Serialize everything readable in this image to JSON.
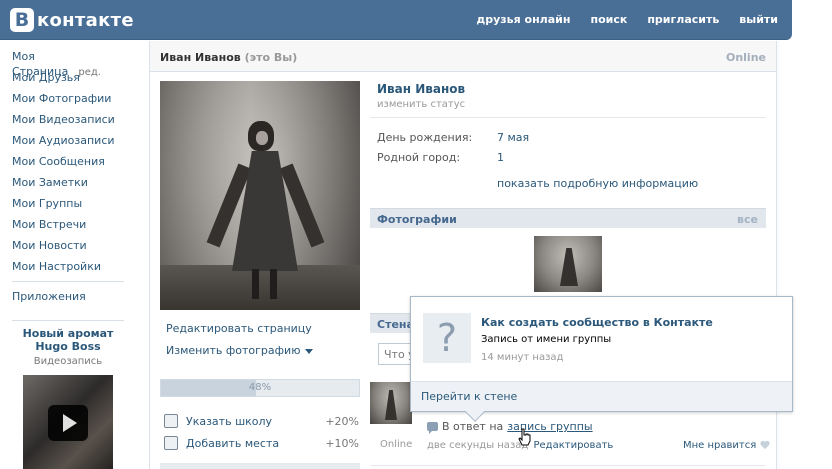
{
  "header": {
    "logo_letter": "B",
    "logo_text": "контакте",
    "nav": [
      "друзья онлайн",
      "поиск",
      "пригласить",
      "выйти"
    ]
  },
  "leftnav": {
    "items": [
      {
        "label": "Моя Страница",
        "extra": "ред."
      },
      {
        "label": "Мои Друзья"
      },
      {
        "label": "Мои Фотографии"
      },
      {
        "label": "Мои Видеозаписи"
      },
      {
        "label": "Мои Аудиозаписи"
      },
      {
        "label": "Мои Сообщения"
      },
      {
        "label": "Мои Заметки"
      },
      {
        "label": "Мои Группы"
      },
      {
        "label": "Мои Встречи"
      },
      {
        "label": "Мои Новости"
      },
      {
        "label": "Мои Настройки"
      }
    ],
    "apps": "Приложения"
  },
  "ad": {
    "title": "Новый аромат Hugo Boss",
    "subtitle": "Видеозапись"
  },
  "profile": {
    "title": "Иван Иванов",
    "title_note": "(это Вы)",
    "online": "Online",
    "name": "Иван Иванов",
    "change_status": "изменить статус",
    "birthday_label": "День рождения:",
    "birthday_value": "7 мая",
    "city_label": "Родной город:",
    "city_value": "1",
    "more_info": "показать подробную информацию",
    "edit_page": "Редактировать страницу",
    "change_photo": "Изменить фотографию",
    "progress_label": "48%",
    "progress_value": 48,
    "suggestions": [
      {
        "label": "Указать школу",
        "pct": "+20%",
        "icon": "school-icon"
      },
      {
        "label": "Добавить места",
        "pct": "+10%",
        "icon": "places-icon"
      }
    ]
  },
  "photos": {
    "title": "Фотографии",
    "all": "все"
  },
  "wall": {
    "title": "Стена",
    "input_placeholder": "Что у",
    "post": {
      "online": "Online",
      "reply_prefix": "В ответ на",
      "reply_link": "запись группы",
      "time": "две секунды назад",
      "edit": "Редактировать",
      "like": "Мне нравится"
    }
  },
  "popup": {
    "icon": "?",
    "title": "Как создать сообщество в Контакте",
    "subtitle": "Запись от имени группы",
    "time": "14 минут назад",
    "footer_link": "Перейти к стене"
  },
  "colors": {
    "header": "#4a6f96",
    "link": "#2b587a",
    "section_bar": "#e1e7ed"
  }
}
